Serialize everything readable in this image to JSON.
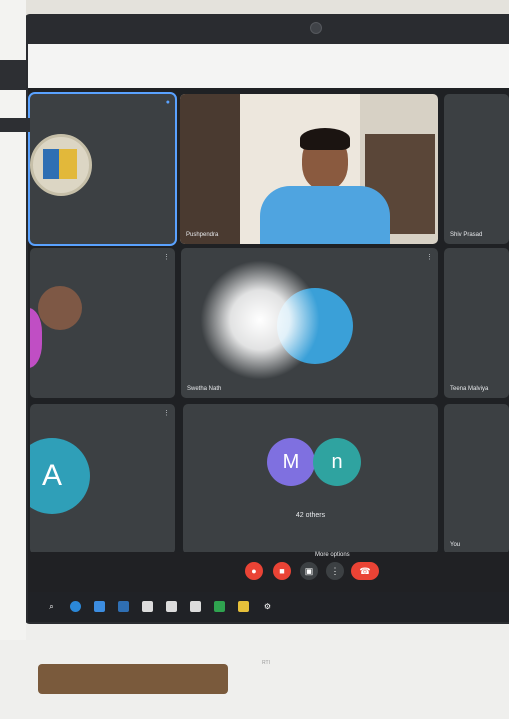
{
  "meeting": {
    "tiles": {
      "presenter_name": "Pushpendra",
      "shiv_name": "Shiv Prasad",
      "center_name": "Swetha Nath",
      "teena_name": "Teena Malviya",
      "small_name": "You",
      "others_label": "42 others",
      "avatar_a": "A",
      "avatar_m": "M",
      "avatar_n": "n"
    },
    "controls": {
      "tooltip": "More options"
    },
    "colors": {
      "tile": "#3c4043",
      "active_border": "#5aa2ff",
      "avatar_purple": "#7f70e0",
      "avatar_teal": "#2fa3a0",
      "avatar_blue": "#3aa0d8",
      "end_call": "#ea4335"
    }
  },
  "footer": {
    "below_text": "RTI"
  }
}
